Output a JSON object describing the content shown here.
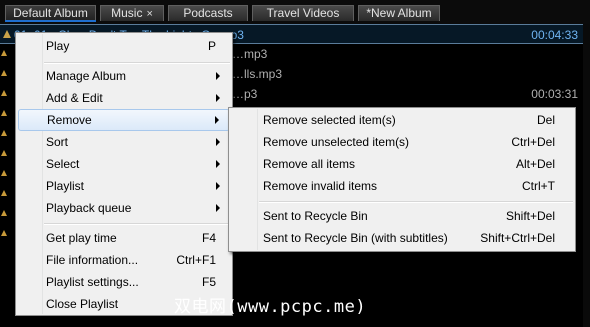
{
  "tabs": [
    {
      "label": "Default Album",
      "active": true
    },
    {
      "label": "Music",
      "close": "×"
    },
    {
      "label": "Podcasts"
    },
    {
      "label": "Travel Videos"
    },
    {
      "label": "*New Album"
    }
  ],
  "playlist": {
    "rows": [
      {
        "title": "01. 01 - Ch… Don't T… The Lights On.mp3",
        "duration": "00:04:33"
      },
      {
        "title": "…mp3",
        "duration": ""
      },
      {
        "title": "…lls.mp3",
        "duration": ""
      },
      {
        "title": "…p3",
        "duration": "00:03:31"
      }
    ]
  },
  "context_menu": {
    "items": [
      {
        "label": "Play",
        "shortcut": "P"
      },
      {
        "label": "Manage Album",
        "submenu": true
      },
      {
        "label": "Add & Edit",
        "submenu": true
      },
      {
        "label": "Remove",
        "submenu": true,
        "highlighted": true
      },
      {
        "label": "Sort",
        "submenu": true
      },
      {
        "label": "Select",
        "submenu": true
      },
      {
        "label": "Playlist",
        "submenu": true
      },
      {
        "label": "Playback queue",
        "submenu": true
      },
      {
        "label": "Get play time",
        "shortcut": "F4"
      },
      {
        "label": "File information...",
        "shortcut": "Ctrl+F1"
      },
      {
        "label": "Playlist settings...",
        "shortcut": "F5"
      },
      {
        "label": "Close Playlist",
        "shortcut": ""
      }
    ]
  },
  "remove_submenu": {
    "items": [
      {
        "label": "Remove selected item(s)",
        "shortcut": "Del"
      },
      {
        "label": "Remove unselected item(s)",
        "shortcut": "Ctrl+Del"
      },
      {
        "label": "Remove all items",
        "shortcut": "Alt+Del"
      },
      {
        "label": "Remove invalid items",
        "shortcut": "Ctrl+T"
      },
      {
        "label": "Sent to Recycle Bin",
        "shortcut": "Shift+Del"
      },
      {
        "label": "Sent to Recycle Bin (with subtitles)",
        "shortcut": "Shift+Ctrl+Del"
      }
    ]
  },
  "watermark": "双电网(www.pcpc.me)",
  "colors": {
    "accent": "#1e6fd0",
    "selected_text": "#6fb3f0",
    "menu_bg": "#f0f0f0"
  }
}
